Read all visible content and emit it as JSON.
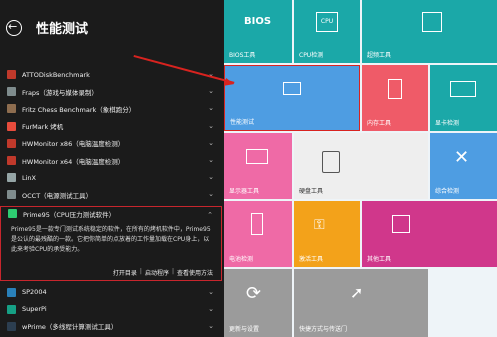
{
  "header": {
    "title": "性能测试"
  },
  "list": [
    {
      "label": "ATTODiskBenchmark",
      "color": "#c0392b"
    },
    {
      "label": "Fraps（游戏与媒体录制）",
      "color": "#7f8c8d"
    },
    {
      "label": "Fritz Chess Benchmark（象棋跑分）",
      "color": "#8e6d4f"
    },
    {
      "label": "FurMark 烤机",
      "color": "#e74c3c"
    },
    {
      "label": "HWMonitor x86（电脑温度检测）",
      "color": "#c0392b"
    },
    {
      "label": "HWMonitor x64（电脑温度检测）",
      "color": "#c0392b"
    },
    {
      "label": "LinX",
      "color": "#95a5a6"
    },
    {
      "label": "OCCT（电源测试工具）",
      "color": "#7f8c8d"
    }
  ],
  "expanded": {
    "label": "Prime95（CPU压力测试软件）",
    "color": "#2ecc71",
    "description": "Prime95是一款专门测试系统稳定的软件，在所有的烤机软件中，Prime95是公认的最残酷的一款。它把你简单的点放着的工作量加载在CPU身上，以此来考验CPU的承受能力。",
    "links": [
      "打开目录",
      "启动程序",
      "查看使用方法"
    ]
  },
  "list_after": [
    {
      "label": "SP2004",
      "color": "#2980b9"
    },
    {
      "label": "SuperPi",
      "color": "#16a085"
    },
    {
      "label": "wPrime（多线程计算测试工具）",
      "color": "#2c3e50"
    }
  ],
  "tiles": {
    "bios": {
      "label": "BIOS工具",
      "icon_text": "BIOS"
    },
    "cpu": {
      "label": "CPU检测",
      "icon_text": "CPU"
    },
    "overclock": {
      "label": "超频工具"
    },
    "perf": {
      "label": "性能测试"
    },
    "memory": {
      "label": "内存工具"
    },
    "gpu": {
      "label": "显卡检测"
    },
    "display": {
      "label": "显示器工具"
    },
    "disk": {
      "label": "硬盘工具"
    },
    "misc": {
      "label": "综合检测"
    },
    "battery": {
      "label": "电池检测"
    },
    "activate": {
      "label": "激活工具"
    },
    "other": {
      "label": "其他工具"
    },
    "update": {
      "label": "更新与设置"
    },
    "shortcut": {
      "label": "快捷方式与传送门"
    }
  },
  "colors": {
    "accent_red": "#d8231f",
    "teal": "#1ba8a8",
    "blue": "#4e9de2",
    "pink": "#ef5b80",
    "orange": "#f3a21a",
    "magenta": "#d0378b",
    "gray": "#9b9b9b"
  }
}
